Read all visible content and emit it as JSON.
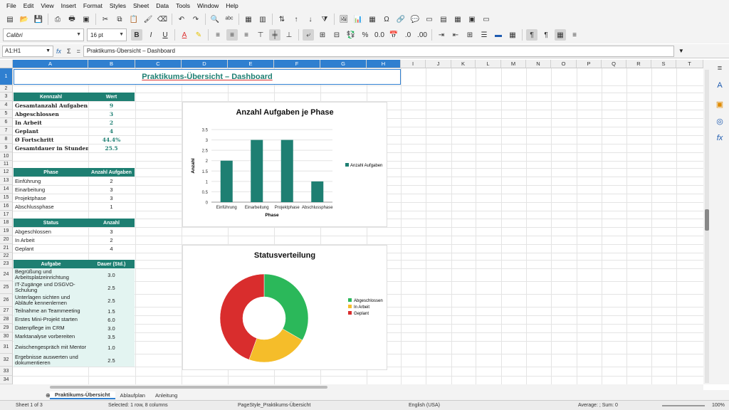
{
  "menu": [
    "File",
    "Edit",
    "View",
    "Insert",
    "Format",
    "Styles",
    "Sheet",
    "Data",
    "Tools",
    "Window",
    "Help"
  ],
  "font": {
    "name": "Calibri",
    "size": "16 pt"
  },
  "namebox": "A1:H1",
  "formula": "Praktikums-Übersicht – Dashboard",
  "columns": [
    "A",
    "B",
    "C",
    "D",
    "E",
    "F",
    "G",
    "H",
    "I",
    "J",
    "K",
    "L",
    "M",
    "N",
    "O",
    "P",
    "Q",
    "R",
    "S",
    "T"
  ],
  "rows": [
    "1",
    "2",
    "3",
    "4",
    "5",
    "6",
    "7",
    "8",
    "9",
    "10",
    "11",
    "12",
    "13",
    "14",
    "15",
    "16",
    "17",
    "18",
    "19",
    "20",
    "21",
    "22",
    "23",
    "24",
    "25",
    "26",
    "27",
    "28",
    "29",
    "30",
    "31",
    "32",
    "33",
    "34"
  ],
  "title": "Praktikums-Übersicht – Dashboard",
  "kpi": {
    "header": [
      "Kennzahl",
      "Wert"
    ],
    "rows": [
      [
        "Gesamtanzahl Aufgaben",
        "9"
      ],
      [
        "Abgeschlossen",
        "3"
      ],
      [
        "In Arbeit",
        "2"
      ],
      [
        "Geplant",
        "4"
      ],
      [
        "Ø Fortschritt",
        "44.4%"
      ],
      [
        "Gesamtdauer in Stunden",
        "25.5"
      ]
    ]
  },
  "phase": {
    "header": [
      "Phase",
      "Anzahl Aufgaben"
    ],
    "rows": [
      [
        "Einführung",
        "2"
      ],
      [
        "Einarbeitung",
        "3"
      ],
      [
        "Projektphase",
        "3"
      ],
      [
        "Abschlussphase",
        "1"
      ]
    ]
  },
  "status": {
    "header": [
      "Status",
      "Anzahl"
    ],
    "rows": [
      [
        "Abgeschlossen",
        "3"
      ],
      [
        "In Arbeit",
        "2"
      ],
      [
        "Geplant",
        "4"
      ]
    ]
  },
  "tasks": {
    "header": [
      "Aufgabe",
      "Dauer (Std.)"
    ],
    "rows": [
      [
        "Begrüßung und Arbeitsplatzeinrichtung",
        "3.0"
      ],
      [
        "IT-Zugänge und DSGVO-Schulung",
        "2.5"
      ],
      [
        "Unterlagen sichten und Abläufe kennenlernen",
        "2.5"
      ],
      [
        "Teilnahme an Teammeeting",
        "1.5"
      ],
      [
        "Erstes Mini-Projekt starten",
        "6.0"
      ],
      [
        "Datenpflege im CRM",
        "3.0"
      ],
      [
        "Marktanalyse vorbereiten",
        "3.5"
      ],
      [
        "Zwischengespräch mit Mentor",
        "1.0"
      ],
      [
        "Ergebnisse auswerten und dokumentieren",
        "2.5"
      ]
    ]
  },
  "chart_data": [
    {
      "type": "bar",
      "title": "Anzahl Aufgaben je Phase",
      "xlabel": "Phase",
      "ylabel": "Anzahl",
      "categories": [
        "Einführung",
        "Einarbeitung",
        "Projektphase",
        "Abschlussphase"
      ],
      "series": [
        {
          "name": "Anzahl Aufgaben",
          "values": [
            2,
            3,
            3,
            1
          ]
        }
      ],
      "ylim": [
        0,
        3.5
      ],
      "yticks": [
        "0",
        "0.5",
        "1",
        "1.5",
        "2",
        "2.5",
        "3",
        "3.5"
      ],
      "color": "#1e7f72",
      "legend": "right"
    },
    {
      "type": "pie",
      "title": "Statusverteilung",
      "donut": true,
      "labels": [
        "Abgeschlossen",
        "In Arbeit",
        "Geplant"
      ],
      "values": [
        3,
        2,
        4
      ],
      "colors": [
        "#2bb85a",
        "#f5bd2a",
        "#d92d2d"
      ],
      "legend": "right"
    }
  ],
  "sheets": [
    "Praktikums-Übersicht",
    "Ablaufplan",
    "Anleitung"
  ],
  "status_bar": {
    "sheet": "Sheet 1 of 3",
    "selection": "Selected: 1 row, 8 columns",
    "pagestyle": "PageStyle_Praktikums-Übersicht",
    "lang": "English (USA)",
    "calc": "Average: ; Sum: 0",
    "zoom": "100%"
  }
}
